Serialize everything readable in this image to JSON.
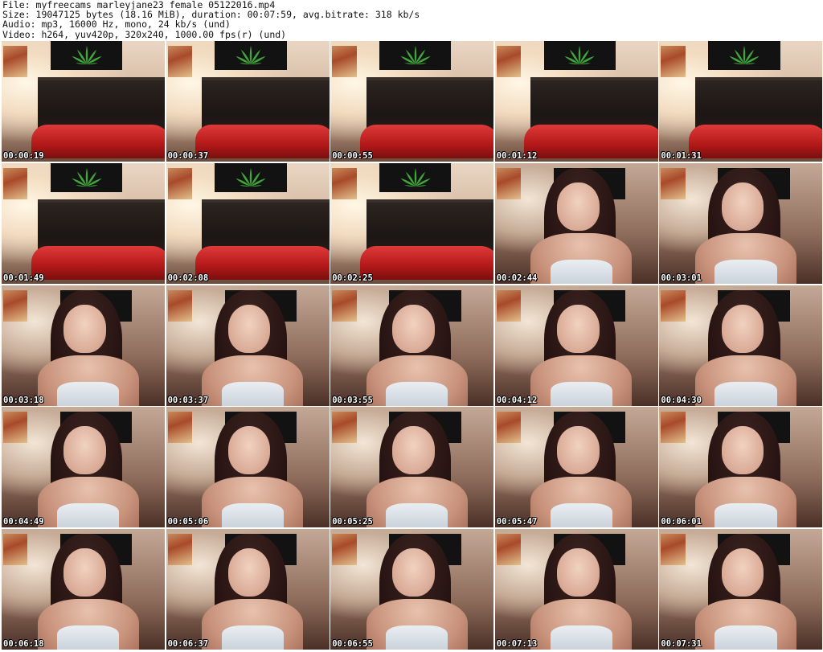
{
  "header": {
    "file_line": "File: myfreecams_marleyjane23_female_05122016.mp4",
    "size_line": "Size: 19047125 bytes (18.16 MiB), duration: 00:07:59, avg.bitrate: 318 kb/s",
    "audio_line": "Audio: mp3, 16000 Hz, mono, 24 kb/s (und)",
    "video_line": "Video: h264, yuv420p, 320x240, 1000.00 fps(r) (und)"
  },
  "colors": {
    "background": "#ffffff",
    "timestamp_text": "#ffffff",
    "timestamp_outline": "#000000",
    "flag": "#121212",
    "leaf": "#3fa63a",
    "pillow": "#c21e1e"
  },
  "thumbnails": [
    {
      "time": "00:00:19",
      "scene": "bed"
    },
    {
      "time": "00:00:37",
      "scene": "bed"
    },
    {
      "time": "00:00:55",
      "scene": "bed"
    },
    {
      "time": "00:01:12",
      "scene": "bed"
    },
    {
      "time": "00:01:31",
      "scene": "bed"
    },
    {
      "time": "00:01:49",
      "scene": "bed"
    },
    {
      "time": "00:02:08",
      "scene": "bed"
    },
    {
      "time": "00:02:25",
      "scene": "bed"
    },
    {
      "time": "00:02:44",
      "scene": "person"
    },
    {
      "time": "00:03:01",
      "scene": "person"
    },
    {
      "time": "00:03:18",
      "scene": "person"
    },
    {
      "time": "00:03:37",
      "scene": "person"
    },
    {
      "time": "00:03:55",
      "scene": "person"
    },
    {
      "time": "00:04:12",
      "scene": "person"
    },
    {
      "time": "00:04:30",
      "scene": "person"
    },
    {
      "time": "00:04:49",
      "scene": "person"
    },
    {
      "time": "00:05:06",
      "scene": "person"
    },
    {
      "time": "00:05:25",
      "scene": "person"
    },
    {
      "time": "00:05:47",
      "scene": "person"
    },
    {
      "time": "00:06:01",
      "scene": "person"
    },
    {
      "time": "00:06:18",
      "scene": "person"
    },
    {
      "time": "00:06:37",
      "scene": "person"
    },
    {
      "time": "00:06:55",
      "scene": "person"
    },
    {
      "time": "00:07:13",
      "scene": "person"
    },
    {
      "time": "00:07:31",
      "scene": "person"
    }
  ]
}
